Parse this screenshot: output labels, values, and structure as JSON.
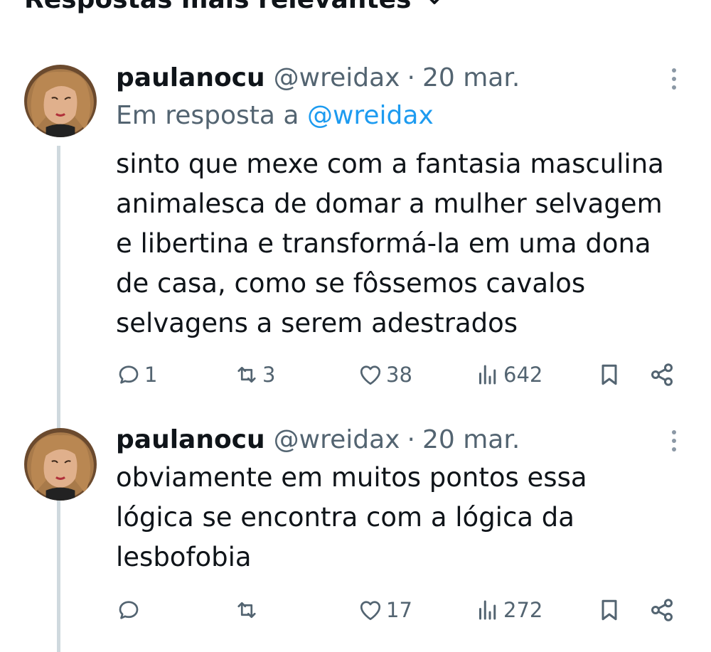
{
  "sort_header": {
    "label": "Respostas mais relevantes"
  },
  "tweets": [
    {
      "name": "paulanocu",
      "handle": "@wreidax",
      "separator": "·",
      "date": "20 mar.",
      "reply_prefix": "Em resposta a",
      "reply_handle": "@wreidax",
      "text": "sinto que mexe com a fantasia masculina\nanimalesca de domar a mulher selvagem\ne libertina e transformá-la em uma dona\nde casa, como se fôssemos cavalos\nselvagens a serem adestrados",
      "replies": "1",
      "retweets": "3",
      "likes": "38",
      "views": "642"
    },
    {
      "name": "paulanocu",
      "handle": "@wreidax",
      "separator": "·",
      "date": "20 mar.",
      "text": "obviamente em muitos pontos essa\nlógica se encontra com a lógica da\nlesbofobia",
      "replies": "",
      "retweets": "",
      "likes": "17",
      "views": "272"
    }
  ],
  "icons": {
    "sort": "chevron-down-icon",
    "more": "more-vertical-icon",
    "reply": "reply-icon",
    "retweet": "retweet-icon",
    "like": "heart-icon",
    "views": "views-icon",
    "bookmark": "bookmark-icon",
    "share": "share-icon"
  },
  "colors": {
    "link": "#1d9bf0",
    "secondary_text": "#536471",
    "thread_line": "#cfd9de"
  }
}
